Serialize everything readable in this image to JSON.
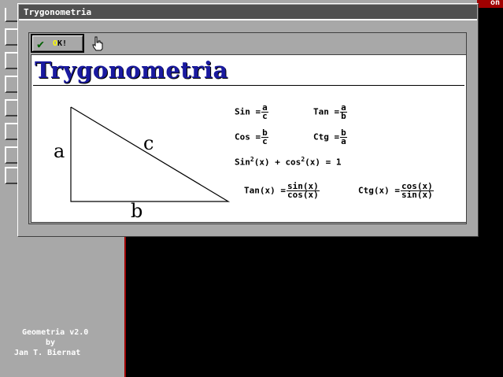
{
  "background_app": {
    "corner_text": "on",
    "credits": {
      "line1": "Geometria v2.0",
      "line2": "by",
      "line3": "Jan T. Biernat"
    }
  },
  "dialog": {
    "title": "Trygonometria",
    "ok_label_hot": "O",
    "ok_label_rest": "K!",
    "heading": "Trygonometria",
    "triangle": {
      "side_a": "a",
      "side_b": "b",
      "side_c": "c"
    },
    "formulas": {
      "sin": {
        "label": "Sin =",
        "num": "a",
        "den": "c"
      },
      "tan": {
        "label": "Tan =",
        "num": "a",
        "den": "b"
      },
      "cos": {
        "label": "Cos =",
        "num": "b",
        "den": "c"
      },
      "ctg": {
        "label": "Ctg =",
        "num": "b",
        "den": "a"
      },
      "identity": {
        "sin": "Sin",
        "exp1": "2",
        "mid": "(x) + cos",
        "exp2": "2",
        "rest": "(x) = 1"
      },
      "tanx": {
        "label": "Tan(x) =",
        "num": "sin(x)",
        "den": "cos(x)"
      },
      "ctgx": {
        "label": "Ctg(x) =",
        "num": "cos(x)",
        "den": "sin(x)"
      }
    }
  },
  "colors": {
    "window_gray": "#a8a8a8",
    "title_bar": "#505050",
    "heading_blue": "#1a1aa0",
    "accent_red": "#a00000"
  }
}
